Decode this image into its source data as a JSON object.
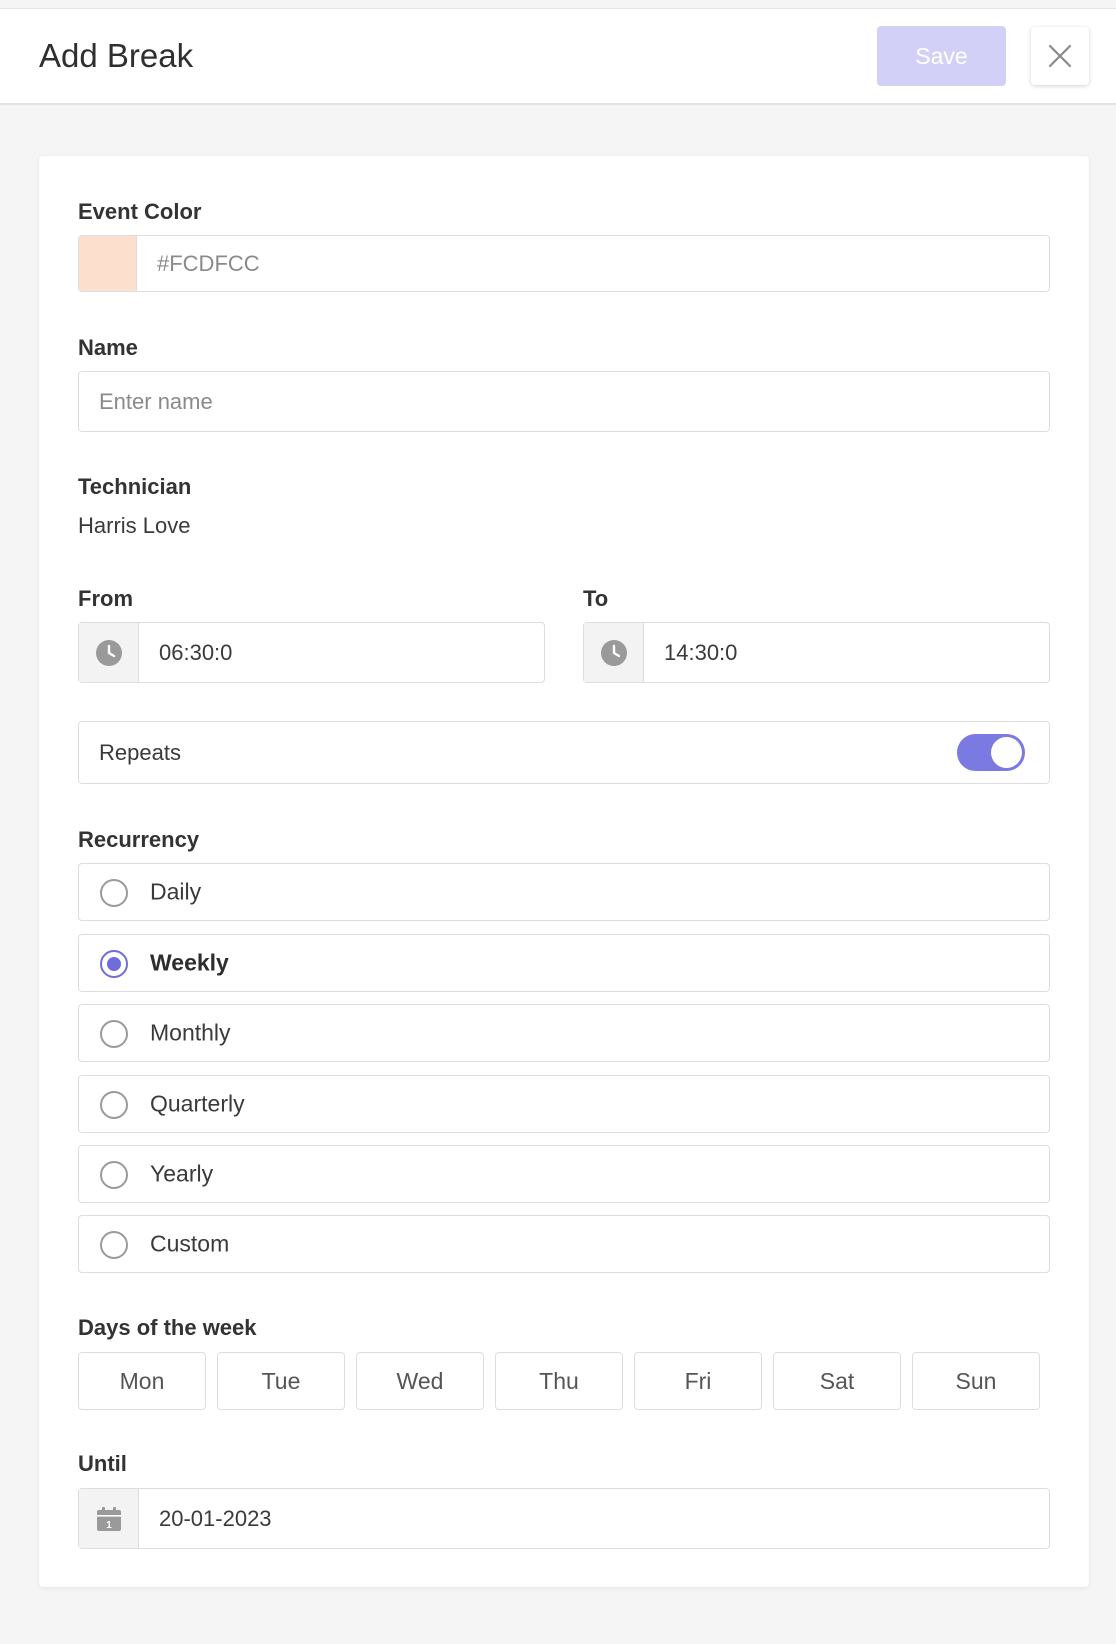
{
  "header": {
    "title": "Add Break",
    "save_label": "Save"
  },
  "form": {
    "event_color": {
      "label": "Event Color",
      "value": "#FCDFCC",
      "swatch_color": "#fcdfcc"
    },
    "name": {
      "label": "Name",
      "placeholder": "Enter name",
      "value": ""
    },
    "technician": {
      "label": "Technician",
      "value": "Harris Love"
    },
    "from": {
      "label": "From",
      "value": "06:30:0"
    },
    "to": {
      "label": "To",
      "value": "14:30:0"
    },
    "repeats": {
      "label": "Repeats",
      "enabled": true
    },
    "recurrency": {
      "label": "Recurrency",
      "options": [
        {
          "label": "Daily",
          "selected": false
        },
        {
          "label": "Weekly",
          "selected": true
        },
        {
          "label": "Monthly",
          "selected": false
        },
        {
          "label": "Quarterly",
          "selected": false
        },
        {
          "label": "Yearly",
          "selected": false
        },
        {
          "label": "Custom",
          "selected": false
        }
      ]
    },
    "days_of_week": {
      "label": "Days of the week",
      "days": [
        "Mon",
        "Tue",
        "Wed",
        "Thu",
        "Fri",
        "Sat",
        "Sun"
      ]
    },
    "until": {
      "label": "Until",
      "value": "20-01-2023",
      "calendar_icon_text": "1"
    }
  },
  "colors": {
    "accent": "#7b79e2",
    "save_disabled": "#d2d0f7"
  },
  "icons": {
    "close": "close-icon",
    "clock": "clock-icon",
    "calendar": "calendar-icon"
  }
}
